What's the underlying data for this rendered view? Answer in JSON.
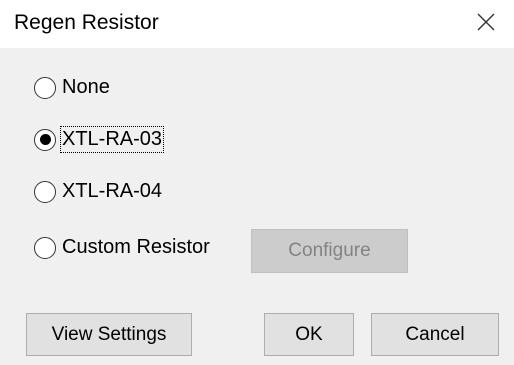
{
  "window": {
    "title": "Regen Resistor",
    "close_icon": "close-icon"
  },
  "options": [
    {
      "label": "None",
      "selected": false
    },
    {
      "label": "XTL-RA-03",
      "selected": true
    },
    {
      "label": "XTL-RA-04",
      "selected": false
    },
    {
      "label": "Custom Resistor",
      "selected": false
    }
  ],
  "buttons": {
    "configure": {
      "label": "Configure",
      "enabled": false
    },
    "view_settings": "View Settings",
    "ok": "OK",
    "cancel": "Cancel"
  }
}
